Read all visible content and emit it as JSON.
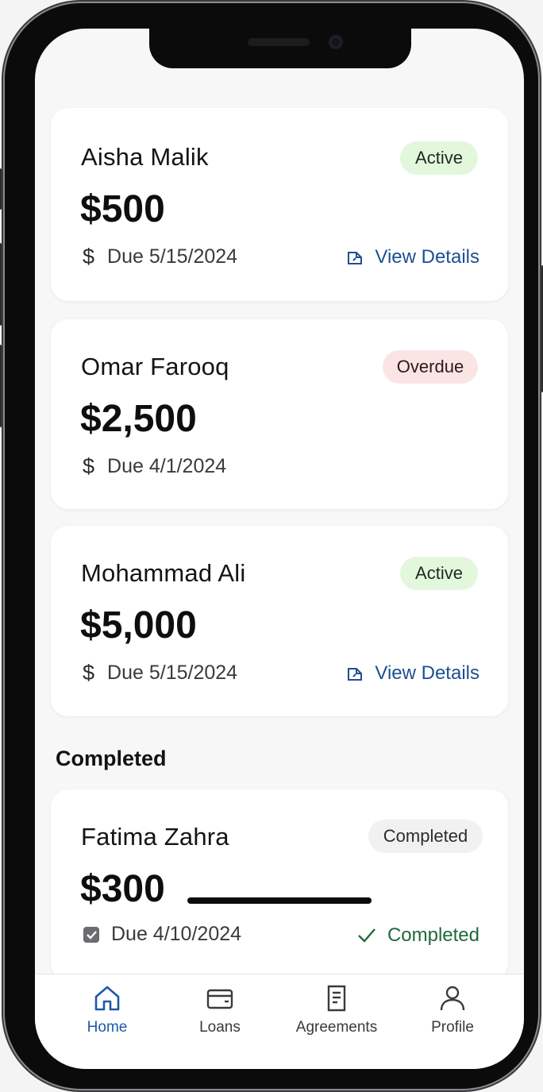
{
  "loans": [
    {
      "name": "Aisha Malik",
      "amount": "$500",
      "due": "Due 5/15/2024",
      "status": "Active",
      "link": "View Details"
    },
    {
      "name": "Omar Farooq",
      "amount": "$2,500",
      "due": "Due 4/1/2024",
      "status": "Overdue"
    },
    {
      "name": "Mohammad Ali",
      "amount": "$5,000",
      "due": "Due 5/15/2024",
      "status": "Active",
      "link": "View Details"
    }
  ],
  "completed_section": {
    "title": "Completed",
    "items": [
      {
        "name": "Fatima Zahra",
        "amount": "$300",
        "due": "Due 4/10/2024",
        "status": "Completed",
        "status_text": "Completed"
      }
    ]
  },
  "dollar_glyph": "$",
  "tabs": [
    {
      "label": "Home",
      "icon": "home-icon",
      "active": true
    },
    {
      "label": "Loans",
      "icon": "wallet-icon",
      "active": false
    },
    {
      "label": "Agreements",
      "icon": "document-icon",
      "active": false
    },
    {
      "label": "Profile",
      "icon": "person-icon",
      "active": false
    }
  ],
  "colors": {
    "accent": "#1d5aa8",
    "active_badge": "#e3f7dd",
    "overdue_badge": "#fbe4e4",
    "completed_badge": "#f1f1f2",
    "completed_text": "#1f6a3a"
  }
}
